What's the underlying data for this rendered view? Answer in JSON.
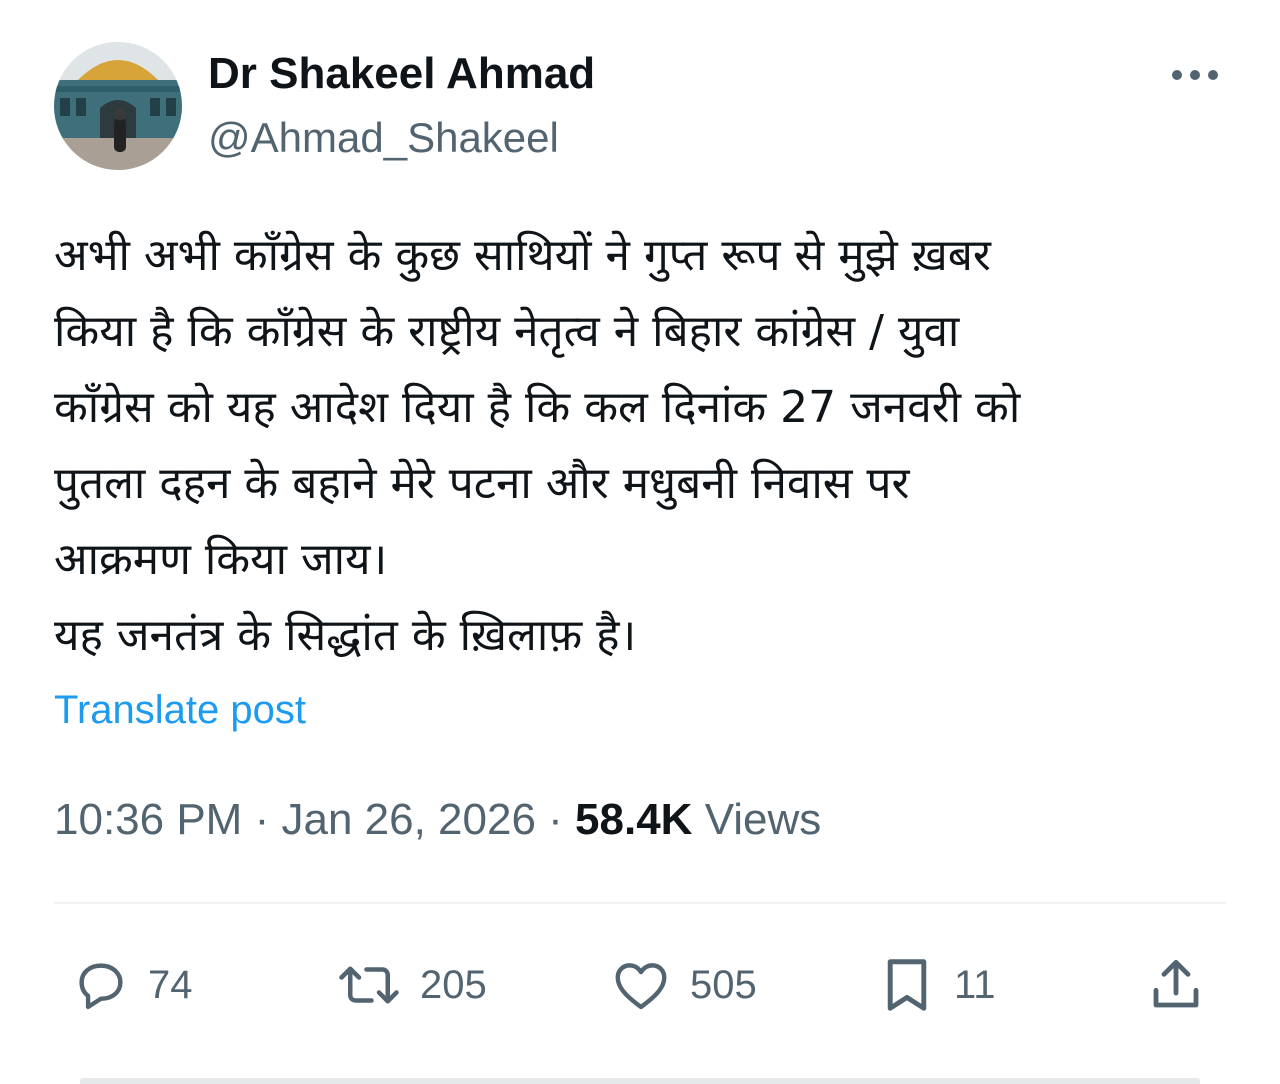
{
  "author": {
    "display_name": "Dr Shakeel Ahmad",
    "handle": "@Ahmad_Shakeel"
  },
  "post": {
    "text_lines": [
      "अभी अभी कॉंग्रेस के कुछ साथियों ने गुप्त रूप से मुझे ख़बर",
      "किया है कि कॉंग्रेस के राष्ट्रीय नेतृत्व ने बिहार कांग्रेस / युवा",
      "कॉंग्रेस को यह आदेश दिया है कि कल दिनांक 27 जनवरी को",
      "पुतला दहन के बहाने मेरे पटना और मधुबनी निवास पर",
      "आक्रमण किया जाय।",
      "यह जनतंत्र के सिद्धांत के ख़िलाफ़ है।"
    ],
    "translate_label": "Translate post",
    "time": "10:36 PM",
    "date": "Jan 26, 2026",
    "separator": "·",
    "views_count": "58.4K",
    "views_label": "Views"
  },
  "actions": {
    "replies": "74",
    "reposts": "205",
    "likes": "505",
    "bookmarks": "11"
  },
  "icons": {
    "more": "more-horizontal-icon",
    "reply": "reply-icon",
    "repost": "repost-icon",
    "like": "heart-icon",
    "bookmark": "bookmark-icon",
    "share": "share-icon"
  },
  "colors": {
    "text_primary": "#0f1419",
    "text_secondary": "#536471",
    "link": "#1d9bf0",
    "divider": "#eff3f4"
  }
}
